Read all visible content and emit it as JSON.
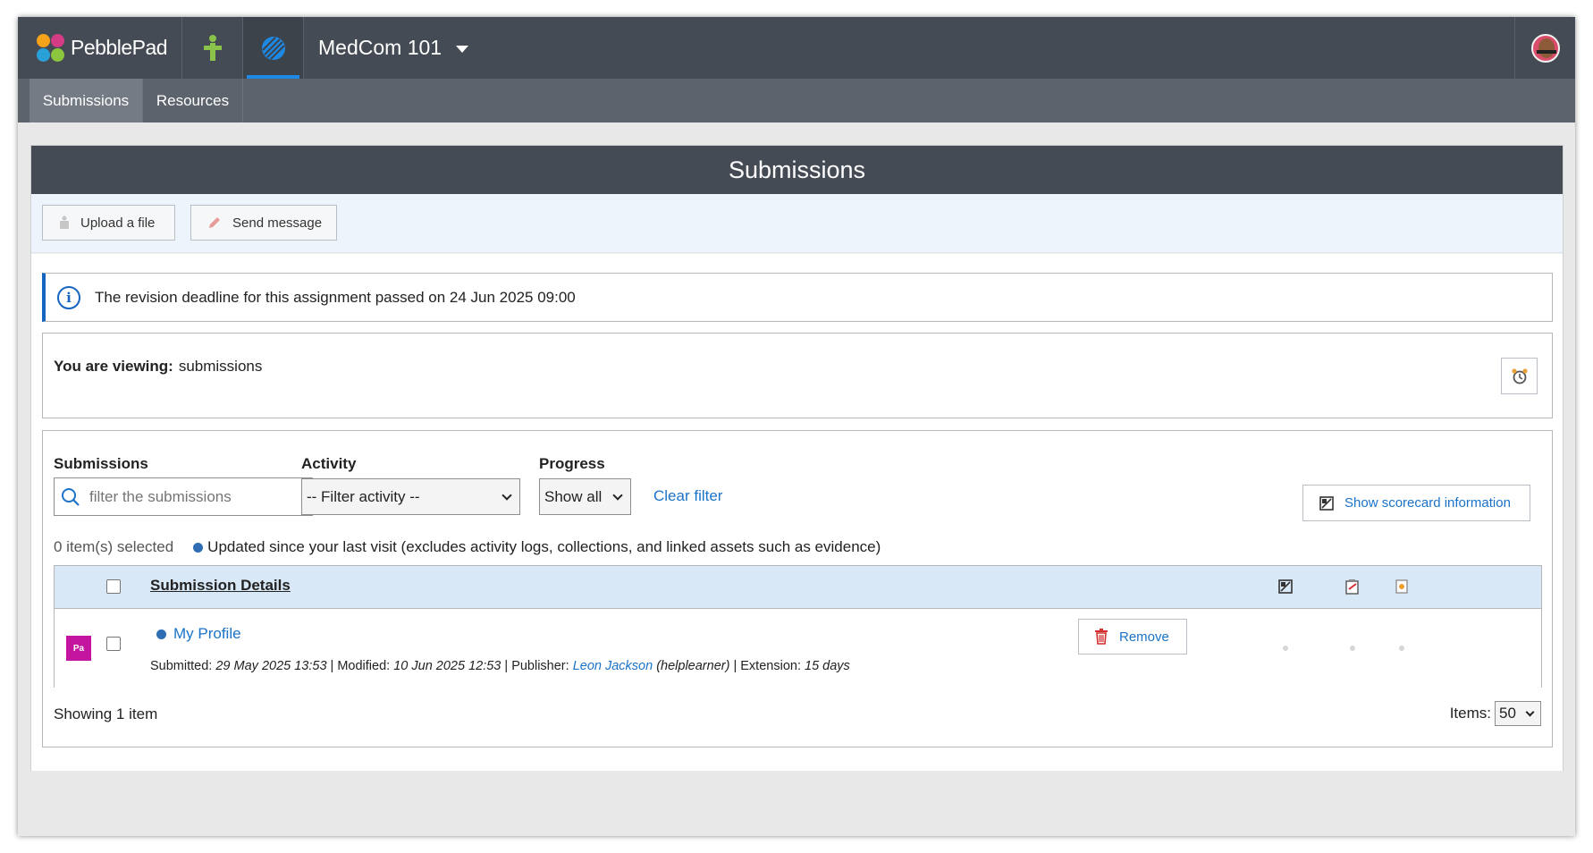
{
  "app": {
    "name": "PebblePad",
    "course": "MedCom 101"
  },
  "subnav": {
    "tabs": [
      {
        "label": "Submissions"
      },
      {
        "label": "Resources"
      }
    ]
  },
  "page": {
    "title": "Submissions"
  },
  "toolbar": {
    "upload_label": "Upload a file",
    "message_label": "Send message"
  },
  "notice": {
    "text": "The revision deadline for this assignment passed on 24 Jun 2025 09:00"
  },
  "viewing": {
    "label": "You are viewing:",
    "value": "submissions"
  },
  "filters": {
    "submissions_label": "Submissions",
    "search_placeholder": "filter the submissions",
    "activity_label": "Activity",
    "activity_value": "-- Filter activity --",
    "progress_label": "Progress",
    "progress_value": "Show all",
    "clear_label": "Clear filter",
    "scorecard_label": "Show scorecard information"
  },
  "selection": {
    "count_text": "0 item(s) selected",
    "legend_text": "Updated since your last visit (excludes activity logs, collections, and linked assets such as evidence)"
  },
  "table": {
    "header": "Submission Details",
    "rows": [
      {
        "badge": "Pa",
        "title": "My Profile",
        "submitted_label": "Submitted:",
        "submitted": "29 May 2025 13:53",
        "modified_label": "Modified:",
        "modified": "10 Jun 2025 12:53",
        "publisher_label": "Publisher:",
        "publisher": "Leon Jackson",
        "publisher_user": "(helplearner)",
        "extension_label": "Extension:",
        "extension": "15 days",
        "remove_label": "Remove"
      }
    ]
  },
  "footer": {
    "showing": "Showing 1 item",
    "items_label": "Items:",
    "items_value": "50"
  },
  "colors": {
    "accent": "#1a73c8",
    "topbar": "#454b54",
    "badge": "#c3159f",
    "remove": "#d32f2f"
  }
}
